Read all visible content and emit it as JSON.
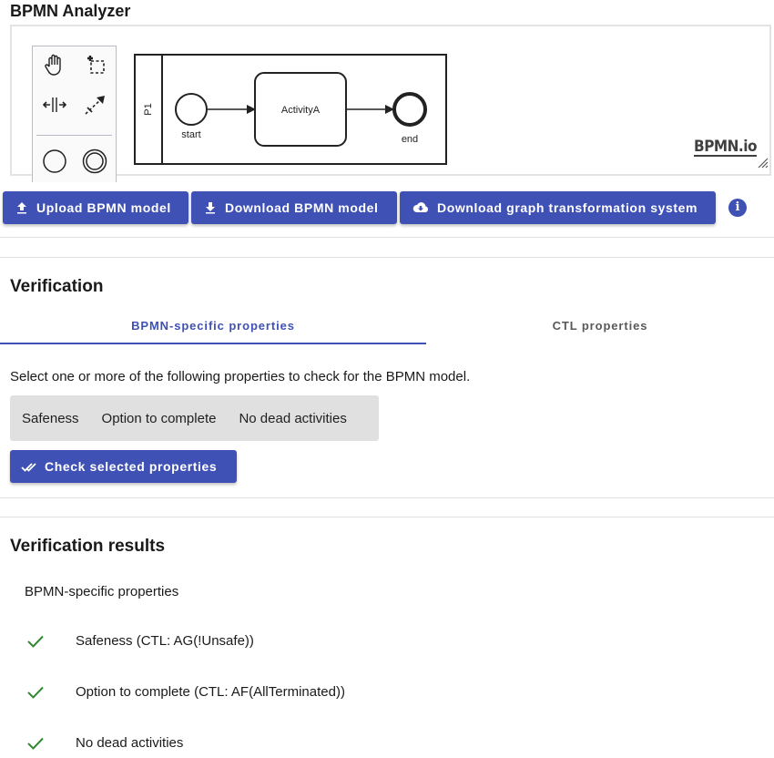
{
  "app": {
    "title": "BPMN Analyzer"
  },
  "diagram": {
    "pool_label": "P1",
    "start_event_label": "start",
    "task_label": "ActivityA",
    "end_event_label": "end",
    "logo_text": "BPMN.io"
  },
  "palette": {
    "tools": [
      "hand-tool-icon",
      "lasso-tool-icon",
      "space-tool-icon",
      "global-connect-tool-icon",
      "start-event-icon",
      "intermediate-event-icon"
    ]
  },
  "toolbar": {
    "upload_label": "Upload BPMN model",
    "download_label": "Download BPMN model",
    "download_gts_label": "Download graph transformation system",
    "info_glyph": "i"
  },
  "verification": {
    "title": "Verification",
    "tabs": [
      {
        "label": "BPMN-specific properties",
        "active": true
      },
      {
        "label": "CTL properties",
        "active": false
      }
    ],
    "instruction": "Select one or more of the following properties to check for the BPMN model.",
    "properties": [
      "Safeness",
      "Option to complete",
      "No dead activities"
    ],
    "check_button_label": "Check selected properties"
  },
  "results": {
    "title": "Verification results",
    "group_label": "BPMN-specific properties",
    "items": [
      {
        "label": "Safeness (CTL: AG(!Unsafe))",
        "status": "passed"
      },
      {
        "label": "Option to complete (CTL: AF(AllTerminated))",
        "status": "passed"
      },
      {
        "label": "No dead activities",
        "status": "passed"
      }
    ]
  },
  "colors": {
    "primary": "#3f51b5",
    "success": "#2e8b2e",
    "chip_bg": "#e0e0e0"
  }
}
